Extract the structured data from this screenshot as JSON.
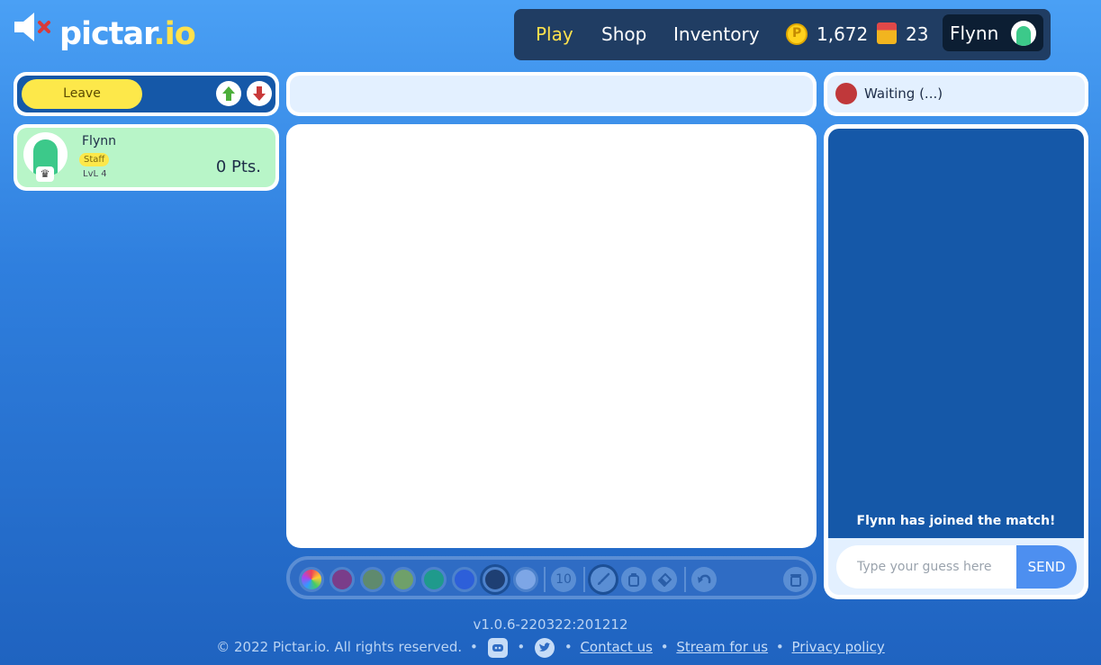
{
  "header": {
    "logo_main": "pictar",
    "logo_suffix": ".io",
    "nav": {
      "play": "Play",
      "shop": "Shop",
      "inventory": "Inventory"
    },
    "coins": "1,672",
    "gems": "23",
    "user_name": "Flynn"
  },
  "lobby": {
    "leave_label": "Leave"
  },
  "players": [
    {
      "name": "Flynn",
      "badge": "Staff",
      "level": "LvL 4",
      "points": "0 Pts."
    }
  ],
  "status": {
    "text": "Waiting (...)"
  },
  "toolbar": {
    "colors": [
      "#7a3d8a",
      "#5f8a6e",
      "#6fa06a",
      "#1f9a8c",
      "#2d5fd9",
      "#1e3f73",
      "#7da6e6"
    ],
    "brush_size": "10"
  },
  "chat": {
    "messages": [
      "Flynn has joined the match!"
    ],
    "placeholder": "Type your guess here",
    "send_label": "SEND"
  },
  "footer": {
    "version": "v1.0.6-220322:201212",
    "copyright": "© 2022 Pictar.io. All rights reserved.",
    "links": {
      "contact": "Contact us",
      "stream": "Stream for us",
      "privacy": "Privacy policy"
    }
  },
  "accent_colors": {
    "brand_yellow": "#ffe14d",
    "panel_blue": "#1558a8",
    "nav_bg": "#203d63",
    "player_bg": "#b8f5c8"
  }
}
